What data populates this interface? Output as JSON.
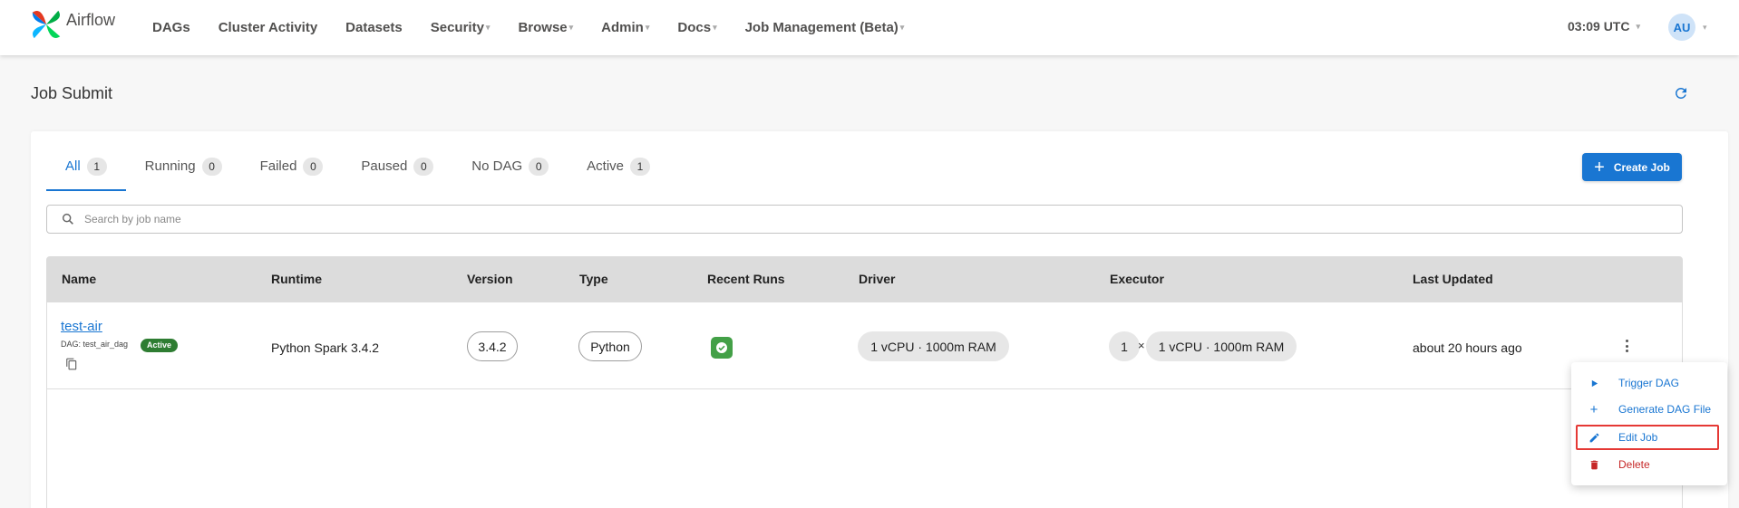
{
  "app": {
    "name": "Airflow"
  },
  "nav": {
    "items": [
      {
        "label": "DAGs",
        "dropdown": false
      },
      {
        "label": "Cluster Activity",
        "dropdown": false
      },
      {
        "label": "Datasets",
        "dropdown": false
      },
      {
        "label": "Security",
        "dropdown": true
      },
      {
        "label": "Browse",
        "dropdown": true
      },
      {
        "label": "Admin",
        "dropdown": true
      },
      {
        "label": "Docs",
        "dropdown": true
      },
      {
        "label": "Job Management (Beta)",
        "dropdown": true
      }
    ],
    "clock": "03:09 UTC",
    "avatar_initials": "AU"
  },
  "page": {
    "title": "Job Submit"
  },
  "tabs": [
    {
      "label": "All",
      "count": "1",
      "active": true
    },
    {
      "label": "Running",
      "count": "0"
    },
    {
      "label": "Failed",
      "count": "0"
    },
    {
      "label": "Paused",
      "count": "0"
    },
    {
      "label": "No DAG",
      "count": "0"
    },
    {
      "label": "Active",
      "count": "1"
    }
  ],
  "create_button": {
    "label": "Create Job"
  },
  "search": {
    "placeholder": "Search by job name",
    "value": ""
  },
  "table": {
    "headers": [
      "Name",
      "Runtime",
      "Version",
      "Type",
      "Recent Runs",
      "Driver",
      "Executor",
      "Last Updated"
    ],
    "rows": [
      {
        "name": "test-air",
        "dag": "DAG: test_air_dag",
        "status": "Active",
        "runtime": "Python Spark 3.4.2",
        "version": "3.4.2",
        "type": "Python",
        "recent_run": "success",
        "driver": "1 vCPU · 1000m RAM",
        "executor_count": "1",
        "executor_times": "×",
        "executor": "1 vCPU · 1000m RAM",
        "last_updated": "about 20 hours ago"
      }
    ]
  },
  "menu": {
    "items": [
      {
        "label": "Trigger DAG",
        "icon": "play-icon"
      },
      {
        "label": "Generate DAG File",
        "icon": "plus-icon"
      },
      {
        "label": "Edit Job",
        "icon": "pencil-icon"
      },
      {
        "label": "Delete",
        "icon": "trash-icon"
      }
    ]
  },
  "colors": {
    "primary": "#1976d2",
    "success": "#2e7d32",
    "danger": "#c62828",
    "highlight": "#e53935"
  }
}
